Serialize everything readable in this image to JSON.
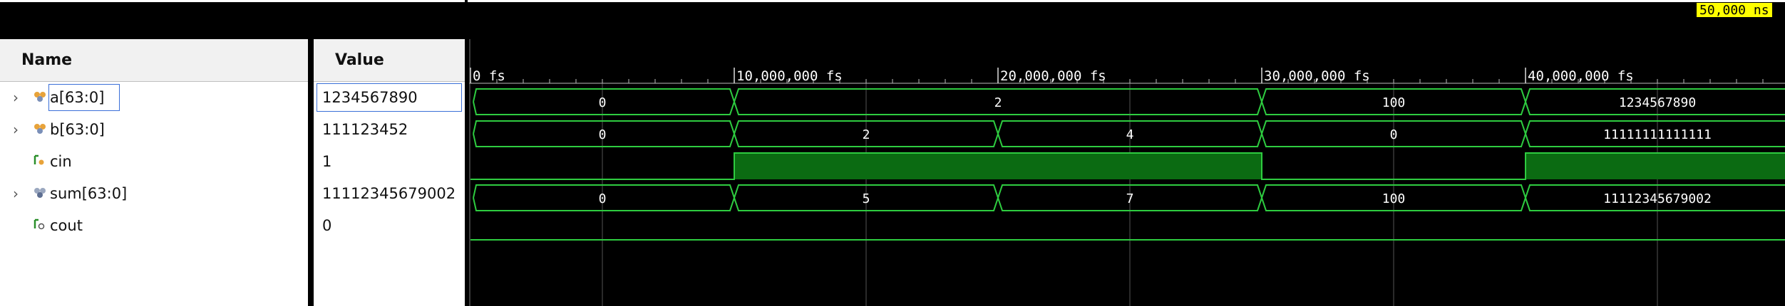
{
  "window": {
    "time_cursor_label": "50,000 ns"
  },
  "columns": {
    "name_header": "Name",
    "value_header": "Value"
  },
  "signals": [
    {
      "name": "a[63:0]",
      "value": "1234567890",
      "type": "bus",
      "icon": "bus-signal-icon"
    },
    {
      "name": "b[63:0]",
      "value": "111123452",
      "type": "bus",
      "icon": "bus-signal-icon"
    },
    {
      "name": "cin",
      "value": "1",
      "type": "bit",
      "icon": "bit-signal-icon"
    },
    {
      "name": "sum[63:0]",
      "value": "11112345679002",
      "type": "bus",
      "icon": "bus-output-icon"
    },
    {
      "name": "cout",
      "value": "0",
      "type": "bit",
      "icon": "bit-output-icon"
    }
  ],
  "timeline": {
    "ticks": [
      "0 fs",
      "10,000,000 fs",
      "20,000,000 fs",
      "30,000,000 fs",
      "40,000,000 fs"
    ]
  },
  "waves": {
    "a": [
      "0",
      "2",
      "100",
      "1234567890"
    ],
    "b": [
      "0",
      "2",
      "4",
      "0",
      "11111111111111"
    ],
    "sum": [
      "0",
      "5",
      "7",
      "100",
      "11112345679002"
    ]
  },
  "colors": {
    "wave_line": "#2ecc40",
    "wave_fill": "#0b6b12",
    "cursor_label_bg": "#ffff00",
    "selection": "#3a6fd8"
  }
}
